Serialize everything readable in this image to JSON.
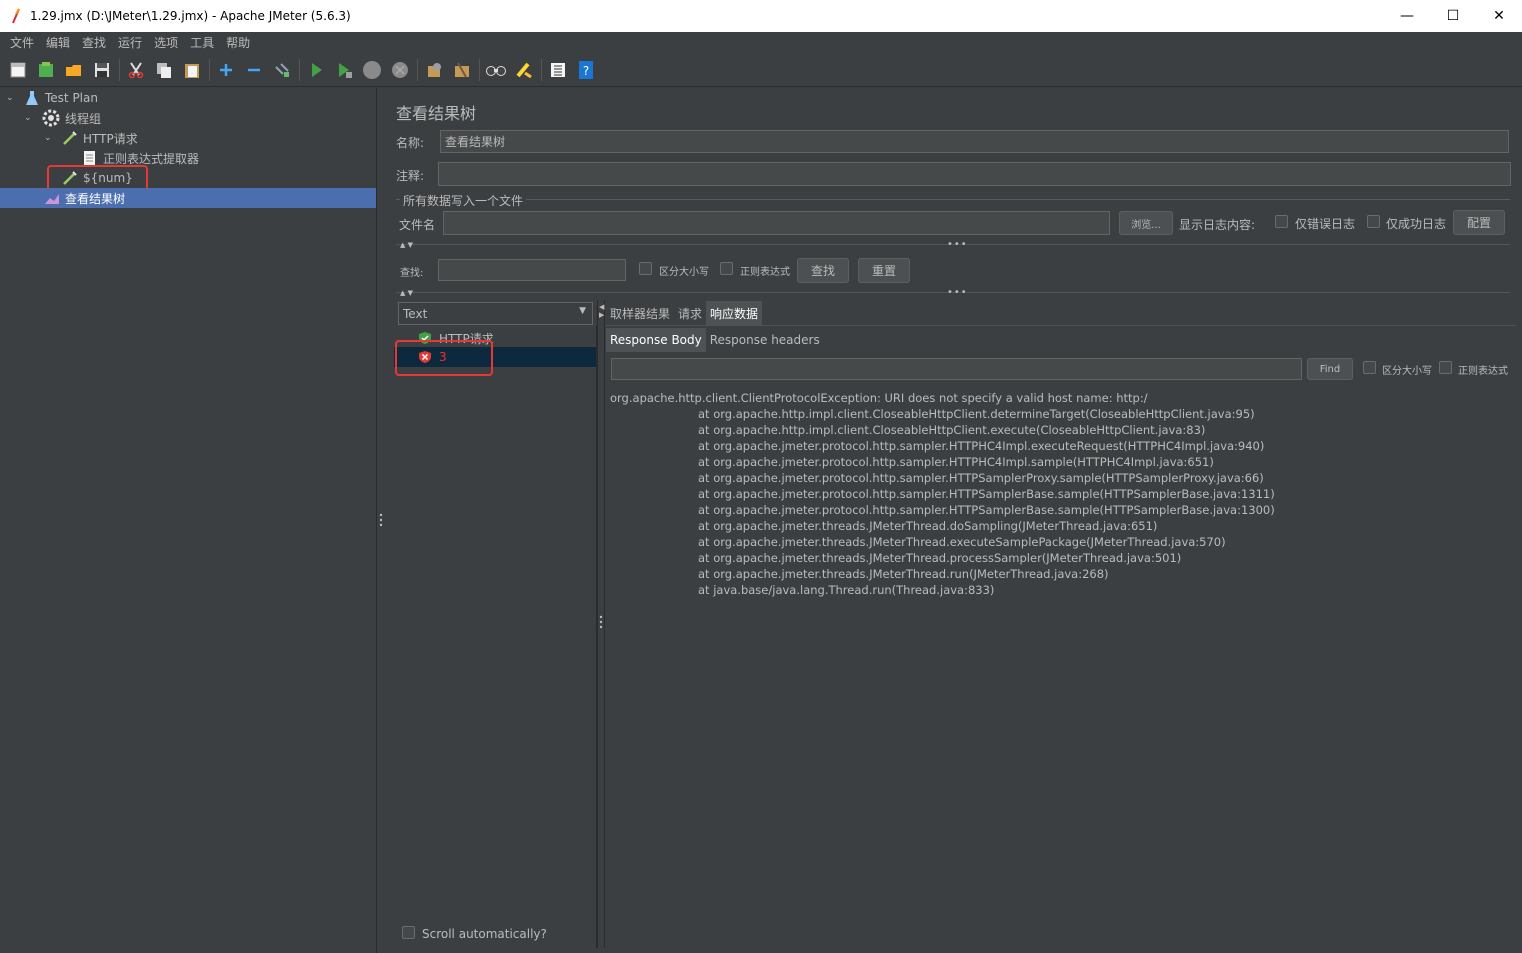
{
  "window": {
    "title": "1.29.jmx (D:\\JMeter\\1.29.jmx) - Apache JMeter (5.6.3)",
    "minimize": "—",
    "maximize": "☐",
    "close": "✕"
  },
  "menu": [
    "文件",
    "编辑",
    "查找",
    "运行",
    "选项",
    "工具",
    "帮助"
  ],
  "toolbar_icons": [
    "new-icon",
    "templates-icon",
    "open-icon",
    "save-icon",
    "cut-icon",
    "copy-icon",
    "paste-icon",
    "expand-icon",
    "collapse-icon",
    "toggle-icon",
    "start-icon",
    "start-no-pause-icon",
    "stop-icon",
    "shutdown-icon",
    "clear-icon",
    "clear-all-icon",
    "search-icon",
    "reset-search-icon",
    "function-helper-icon",
    "help-icon"
  ],
  "tree": {
    "test_plan": "Test Plan",
    "thread_group": "线程组",
    "http_request": "HTTP请求",
    "regex_extractor": "正则表达式提取器",
    "num_sampler": "${num}",
    "view_results_tree": "查看结果树"
  },
  "panel": {
    "heading": "查看结果树",
    "name_label": "名称:",
    "name_value": "查看结果树",
    "comment_label": "注释:",
    "comment_value": "",
    "file_section": "所有数据写入一个文件",
    "filename_label": "文件名",
    "filename_value": "",
    "browse": "浏览...",
    "log_label": "显示日志内容:",
    "errors_only": "仅错误日志",
    "success_only": "仅成功日志",
    "configure": "配置",
    "search_label": "查找:",
    "search_value": "",
    "case_sensitive": "区分大小写",
    "regex": "正则表达式",
    "find_button": "查找",
    "reset_button": "重置",
    "renderer": "Text",
    "scroll_auto": "Scroll automatically?"
  },
  "results": [
    {
      "label": "HTTP请求",
      "status": "success"
    },
    {
      "label": "3",
      "status": "error"
    }
  ],
  "tabs": [
    "取样器结果",
    "请求",
    "响应数据"
  ],
  "subtabs": [
    "Response Body",
    "Response headers"
  ],
  "response_search": {
    "value": "",
    "find": "Find",
    "case_sensitive": "区分大小写",
    "regex": "正则表达式"
  },
  "response_body": {
    "first": "org.apache.http.client.ClientProtocolException: URI does not specify a valid host name: http:/",
    "stack": [
      "at org.apache.http.impl.client.CloseableHttpClient.determineTarget(CloseableHttpClient.java:95)",
      "at org.apache.http.impl.client.CloseableHttpClient.execute(CloseableHttpClient.java:83)",
      "at org.apache.jmeter.protocol.http.sampler.HTTPHC4Impl.executeRequest(HTTPHC4Impl.java:940)",
      "at org.apache.jmeter.protocol.http.sampler.HTTPHC4Impl.sample(HTTPHC4Impl.java:651)",
      "at org.apache.jmeter.protocol.http.sampler.HTTPSamplerProxy.sample(HTTPSamplerProxy.java:66)",
      "at org.apache.jmeter.protocol.http.sampler.HTTPSamplerBase.sample(HTTPSamplerBase.java:1311)",
      "at org.apache.jmeter.protocol.http.sampler.HTTPSamplerBase.sample(HTTPSamplerBase.java:1300)",
      "at org.apache.jmeter.threads.JMeterThread.doSampling(JMeterThread.java:651)",
      "at org.apache.jmeter.threads.JMeterThread.executeSamplePackage(JMeterThread.java:570)",
      "at org.apache.jmeter.threads.JMeterThread.processSampler(JMeterThread.java:501)",
      "at org.apache.jmeter.threads.JMeterThread.run(JMeterThread.java:268)",
      "at java.base/java.lang.Thread.run(Thread.java:833)"
    ]
  }
}
